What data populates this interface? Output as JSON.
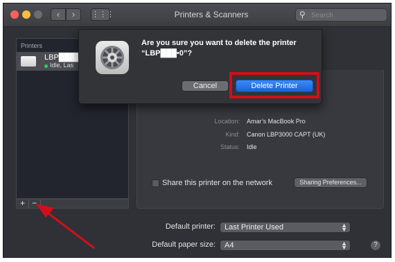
{
  "window": {
    "title": "Printers & Scanners",
    "search_placeholder": "Search"
  },
  "printers": {
    "header": "Printers",
    "items": [
      {
        "name": "LBP████•0",
        "status": "Idle, Las"
      }
    ]
  },
  "list_controls": {
    "add": "+",
    "remove": "−"
  },
  "details": {
    "location_label": "Location:",
    "location_value": "Amar’s MacBook Pro",
    "kind_label": "Kind:",
    "kind_value": "Canon LBP3000 CAPT (UK)",
    "status_label": "Status:",
    "status_value": "Idle"
  },
  "sharing": {
    "checkbox_label": "Share this printer on the network",
    "button_label": "Sharing Preferences..."
  },
  "defaults": {
    "printer_label": "Default printer:",
    "printer_value": "Last Printer Used",
    "paper_label": "Default paper size:",
    "paper_value": "A4",
    "help": "?"
  },
  "dialog": {
    "message": "Are you sure you want to delete the printer\n“LBP███•0”?",
    "cancel_label": "Cancel",
    "delete_label": "Delete Printer"
  },
  "colors": {
    "annotation_red": "#d10f1a",
    "primary_blue": "#1b63d8",
    "status_green": "#2ed158"
  }
}
